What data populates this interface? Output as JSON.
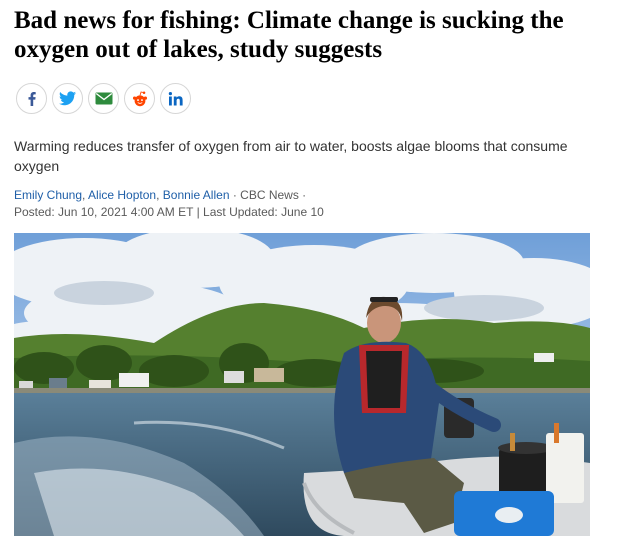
{
  "article": {
    "headline": "Bad news for fishing: Climate change is sucking the oxygen out of lakes, study suggests",
    "deck": "Warming reduces transfer of oxygen from air to water, boosts algae blooms that consume oxygen",
    "authors": [
      "Emily Chung",
      "Alice Hopton",
      "Bonnie Allen"
    ],
    "separator": ", ",
    "source": "· CBC News ·",
    "posted": "Posted: Jun 10, 2021 4:00 AM ET",
    "divider": "|",
    "updated": "Last Updated: June 10"
  },
  "share": {
    "buttons": [
      {
        "icon": "facebook-icon",
        "color": "#3b5998"
      },
      {
        "icon": "twitter-icon",
        "color": "#1da1f2"
      },
      {
        "icon": "email-icon",
        "color": "#2e8b3d"
      },
      {
        "icon": "reddit-icon",
        "color": "#ff4500"
      },
      {
        "icon": "linkedin-icon",
        "color": "#0a66c2"
      }
    ]
  },
  "photo": {
    "subject": "woman-driving-inflatable-boat-on-lake",
    "sky_color": "#5b8fd0",
    "hill_color": "#4d7a2e",
    "water_color": "#3f5f78"
  }
}
